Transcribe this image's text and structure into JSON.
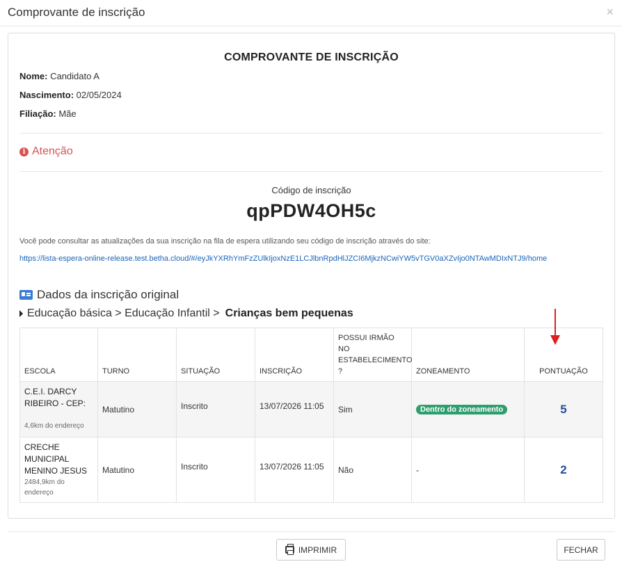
{
  "modal": {
    "title": "Comprovante de inscrição",
    "close_symbol": "×"
  },
  "document": {
    "title": "COMPROVANTE DE INSCRIÇÃO",
    "fields": [
      {
        "label": "Nome:",
        "value": "Candidato A"
      },
      {
        "label": "Nascimento:",
        "value": "02/05/2024"
      },
      {
        "label": "Filiação:",
        "value": "Mãe"
      }
    ],
    "attention": "Atenção"
  },
  "registration": {
    "code_label": "Código de inscrição",
    "code": "qpPDW4OH5c",
    "consult_text": "Você pode consultar as atualizações da sua inscrição na fila de espera utilizando seu código de inscrição através do site:",
    "link": "https://lista-espera-online-release.test.betha.cloud/#/eyJkYXRhYmFzZUlkIjoxNzE1LCJlbnRpdHlJZCI6MjkzNCwiYW5vTGV0aXZvIjo0NTAwMDIxNTJ9/home"
  },
  "original": {
    "section_title": "Dados da inscrição original",
    "breadcrumb_path": "Educação básica > Educação Infantil >",
    "breadcrumb_current": "Crianças bem pequenas",
    "table": {
      "headers": [
        "ESCOLA",
        "TURNO",
        "SITUAÇÃO",
        "INSCRIÇÃO",
        "POSSUI IRMÃO NO ESTABELECIMENTO ?",
        "ZONEAMENTO",
        "PONTUAÇÃO"
      ],
      "rows": [
        {
          "school": "C.E.I. DARCY RIBEIRO - CEP:",
          "distance": "4,6km do endereço",
          "shift": "Matutino",
          "status": "Inscrito",
          "date": "13/07/2026 11:05",
          "sibling": "Sim",
          "zone": "Dentro do zoneamento",
          "score": "5"
        },
        {
          "school": "CRECHE MUNICIPAL MENINO JESUS",
          "distance": "2484,9km do endereço",
          "shift": "Matutino",
          "status": "Inscrito",
          "date": "13/07/2026 11:05",
          "sibling": "Não",
          "zone": "-",
          "score": "2"
        }
      ]
    }
  },
  "footer": {
    "print_label": "IMPRIMIR",
    "close_label": "FECHAR"
  },
  "colors": {
    "attention": "#d9534f",
    "link": "#1a64b8",
    "zone_badge": "#2e9e6e",
    "score": "#1f4e9c",
    "annotation_arrow": "#e02020"
  }
}
